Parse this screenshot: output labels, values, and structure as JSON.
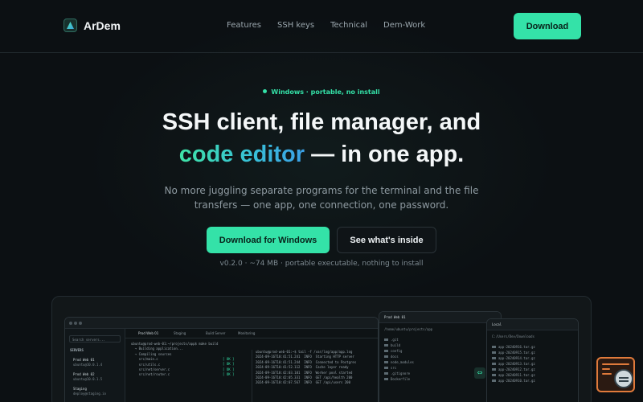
{
  "nav": {
    "brand": "ArDem",
    "links": [
      "Features",
      "SSH keys",
      "Technical",
      "Dem-Work"
    ],
    "download_label": "Download"
  },
  "hero": {
    "badge": "Windows · portable, no install",
    "headline_line1": "SSH client, file manager, and",
    "headline_highlight": "code editor",
    "headline_rest": " — in one app.",
    "subtitle": "No more juggling separate programs for the terminal and the file transfers — one app, one connection, one password.",
    "primary_cta": "Download for Windows",
    "secondary_cta": "See what's inside",
    "meta": "v0.2.0 · ~74 MB · portable executable, nothing to install"
  },
  "preview": {
    "search_placeholder": "Search servers...",
    "servers_header": "SERVERS",
    "servers": [
      {
        "name": "Prod Web 01",
        "host": "ubuntu@10.0.1.4"
      },
      {
        "name": "Prod Web 02",
        "host": "ubuntu@10.0.1.5"
      },
      {
        "name": "Staging",
        "host": "deploy@staging.io"
      }
    ],
    "tabs": [
      "Prod Web 01",
      "Staging",
      "Build Server",
      "Monitoring"
    ],
    "terminal_left": [
      "ubuntu@prod-web-01:~/projects/app$ make build",
      "  → Building application...",
      "  → Compiling sources",
      "    src/main.c",
      "    src/utils.c",
      "    src/net/server.c",
      "    src/net/router.c"
    ],
    "terminal_ok": [
      "[ OK ]",
      "[ OK ]",
      "[ OK ]",
      "[ OK ]"
    ],
    "terminal_right": [
      "ubuntu@prod-web-01:~$ tail -f /var/log/app/app.log",
      "2024-09-16T10:41:51.241  INFO  Starting HTTP server",
      "2024-09-16T10:41:51.244  INFO  Connected to Postgres",
      "2024-09-16T10:41:52.112  INFO  Cache layer ready",
      "2024-09-16T10:42:03.101  INFO  Worker pool started",
      "2024-09-16T10:42:05.331  INFO  GET /api/health 200",
      "2024-09-16T10:42:07.567  INFO  GET /api/users 200"
    ],
    "files_left_title": "Prod Web 01",
    "files_left_path": "/home/ubuntu/projects/app",
    "files_left": [
      ".git",
      "build",
      "config",
      "docs",
      "node_modules",
      "src",
      ".gitignore",
      "Dockerfile"
    ],
    "files_right_title": "Local",
    "files_right_path": "C:/Users/Dev/Downloads",
    "files_right": [
      "app-20240916.tar.gz",
      "app-20240915.tar.gz",
      "app-20240914.tar.gz",
      "app-20240913.tar.gz",
      "app-20240912.tar.gz",
      "app-20240911.tar.gz",
      "app-20240910.tar.gz"
    ]
  }
}
